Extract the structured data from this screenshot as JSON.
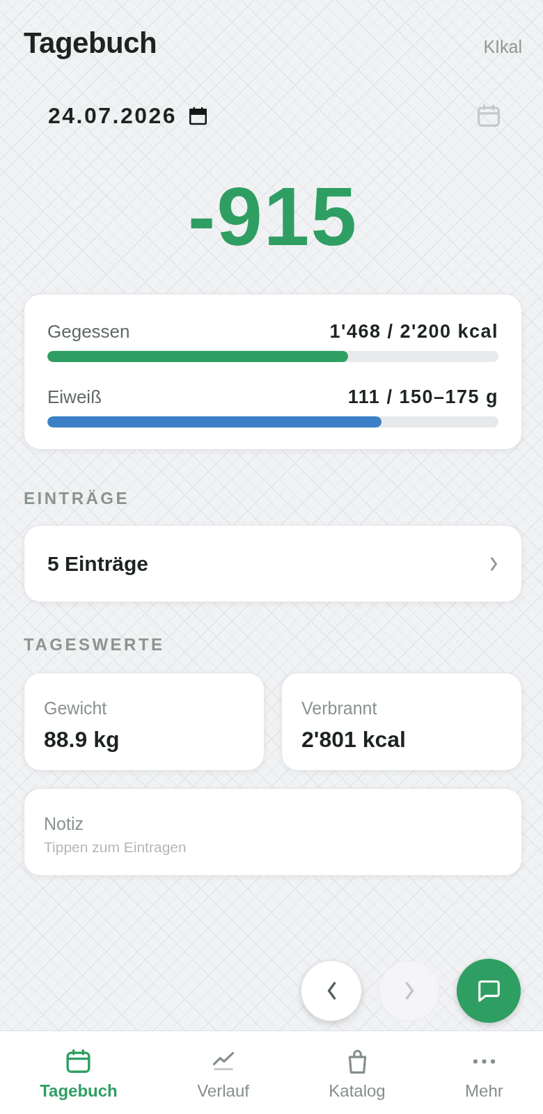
{
  "header": {
    "title": "Tagebuch",
    "unit_toggle": "KIkal"
  },
  "date_bar": {
    "date": "24.07.2026"
  },
  "balance": {
    "value": "-915"
  },
  "progress": [
    {
      "label": "Gegessen",
      "reading": "1'468 / 2'200 kcal",
      "level": 0.667,
      "color": "#2f9e63"
    },
    {
      "label": "Eiweiß",
      "reading": "111 / 150–175 g",
      "level": 0.74,
      "color": "#3b80c6"
    }
  ],
  "entries": {
    "heading": "EINTRÄGE",
    "summary": "5 Einträge"
  },
  "daily_values": {
    "heading": "TAGESWERTE",
    "metrics": [
      {
        "label": "Gewicht",
        "value": "88.9 kg"
      },
      {
        "label": "Verbrannt",
        "value": "2'801 kcal"
      }
    ],
    "note": {
      "label": "Notiz",
      "placeholder": "Tippen zum Eintragen"
    }
  },
  "day_navigation": [
    {
      "kind": "previous",
      "disabled": false
    },
    {
      "kind": "next",
      "disabled": true
    }
  ],
  "tab_bar": [
    {
      "label": "Tagebuch",
      "kind": "calendar",
      "selected": true
    },
    {
      "label": "Verlauf",
      "kind": "chart",
      "selected": false
    },
    {
      "label": "Katalog",
      "kind": "bag",
      "selected": false
    },
    {
      "label": "Mehr",
      "kind": "more",
      "selected": false
    }
  ]
}
